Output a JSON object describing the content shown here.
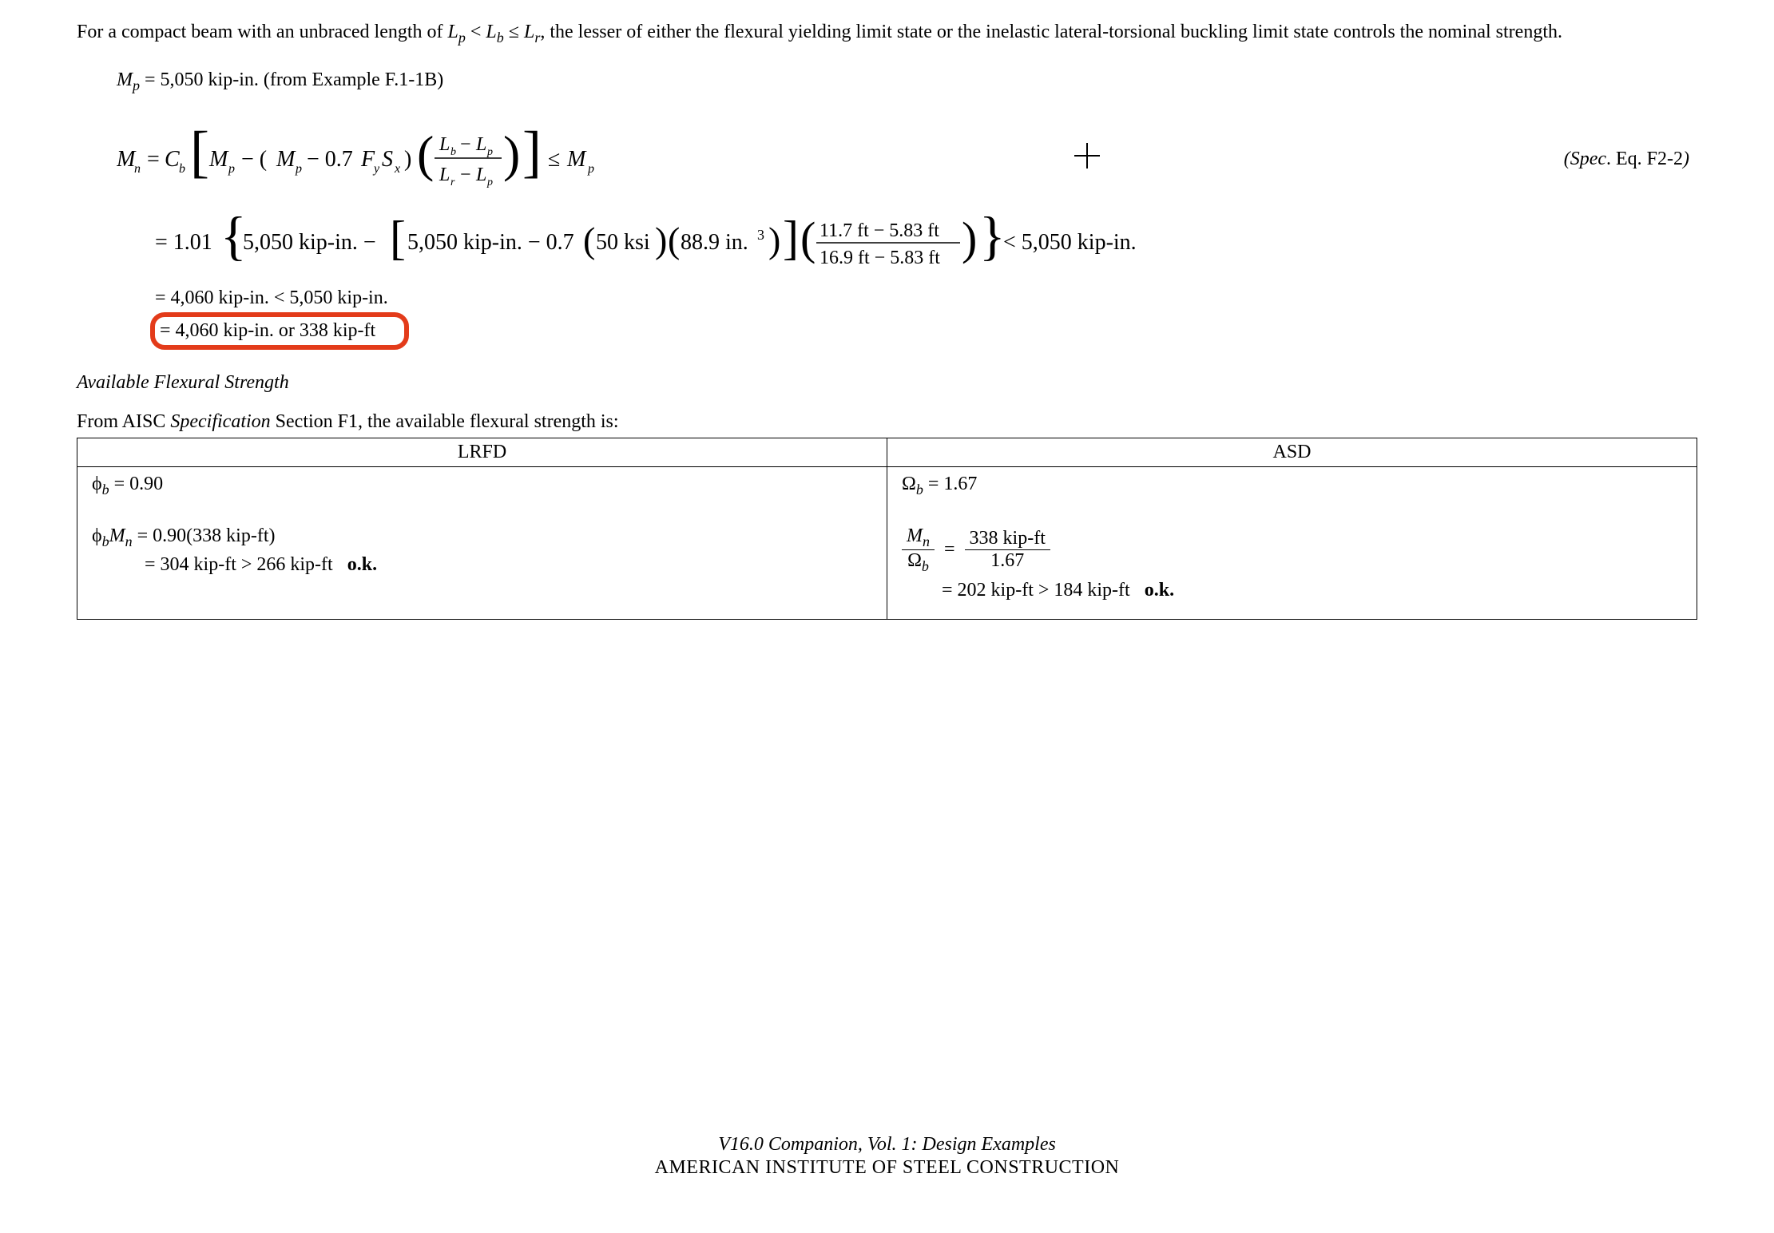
{
  "intro": "For a compact beam with an unbraced length of Lₚ < L_b ≤ L_r, the lesser of either the flexural yielding limit state or the inelastic lateral-torsional buckling limit state controls the nominal strength.",
  "Mp_line": "Mₚ = 5,050 kip-in. (from Example F.1-1B)",
  "equation": {
    "Mn_var": "Mₙ",
    "Cb_var": "C_b",
    "Mp_var": "Mₚ",
    "factor_07FySx": "0.7FᵧSₓ",
    "frac_top": "L_b − Lₚ",
    "frac_bot": "L_r − Lₚ",
    "le": "≤ Mₚ",
    "ref_label": "(Spec. Eq. F2-2)"
  },
  "calc": {
    "Cb_val": "1.01",
    "Mp_val": "5,050 kip-in.",
    "Fy": "50 ksi",
    "Sx": "88.9 in.³",
    "Lb": "11.7 ft",
    "Lp": "5.83 ft",
    "Lr": "16.9 ft",
    "limit": "< 5,050 kip-in."
  },
  "result1": "= 4,060 kip-in. < 5,050 kip-in.",
  "result2": "= 4,060 kip-in. or 338 kip-ft",
  "section_hdr": "Available Flexural Strength",
  "avail_intro": "From AISC Specification Section F1, the available flexural strength is:",
  "table": {
    "lrfd_hdr": "LRFD",
    "asd_hdr": "ASD",
    "phi_b": "ϕ_b = 0.90",
    "omega_b": "Ω_b = 1.67",
    "lrfd_eq_line1": "ϕ_bMₙ = 0.90(338 kip-ft)",
    "lrfd_eq_line2": "= 304 kip-ft > 266 kip-ft   o.k.",
    "asd_frac_num": "Mₙ",
    "asd_frac_den": "Ω_b",
    "asd_rhs_num": "338 kip-ft",
    "asd_rhs_den": "1.67",
    "asd_line2": "= 202 kip-ft > 184 kip-ft   o.k."
  },
  "footer_it": "V16.0 Companion, Vol. 1: Design Examples",
  "footer_up": "AMERICAN INSTITUTE OF STEEL CONSTRUCTION"
}
